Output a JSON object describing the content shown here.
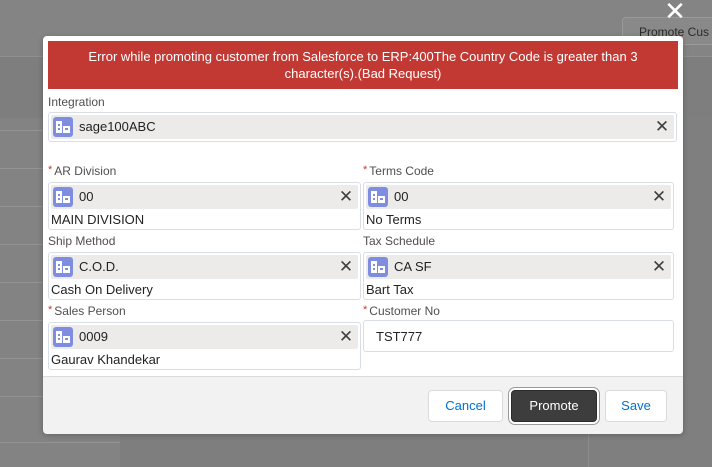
{
  "background": {
    "promote_button_label": "Promote Cus"
  },
  "modal": {
    "error_message": "Error while promoting customer from Salesforce to ERP:400The Country Code is greater than 3 character(s).(Bad Request)",
    "integration": {
      "label": "Integration",
      "value": "sage100ABC"
    },
    "fields": {
      "ar_division": {
        "label": "AR Division",
        "required": true,
        "value": "00",
        "sub_text": "MAIN DIVISION"
      },
      "terms_code": {
        "label": "Terms Code",
        "required": true,
        "value": "00",
        "sub_text": "No Terms"
      },
      "ship_method": {
        "label": "Ship Method",
        "required": false,
        "value": "C.O.D.",
        "sub_text": "Cash On Delivery"
      },
      "tax_schedule": {
        "label": "Tax Schedule",
        "required": false,
        "value": "CA SF",
        "sub_text": "Bart Tax"
      },
      "sales_person": {
        "label": "Sales Person",
        "required": true,
        "value": "0009",
        "sub_text": "Gaurav Khandekar"
      },
      "customer_no": {
        "label": "Customer No",
        "required": true,
        "value": "TST777"
      }
    },
    "required_marker": "*",
    "clear_symbol": "✕",
    "close_symbol": "✕",
    "buttons": {
      "cancel": "Cancel",
      "promote": "Promote",
      "save": "Save"
    },
    "icons": {
      "lookup": "record-lookup-icon",
      "clear": "clear-icon",
      "close": "close-icon"
    },
    "colors": {
      "error_banner": "#c23934",
      "lookup_icon": "#7f8de1",
      "brand_button": "#3d3d3d"
    }
  }
}
